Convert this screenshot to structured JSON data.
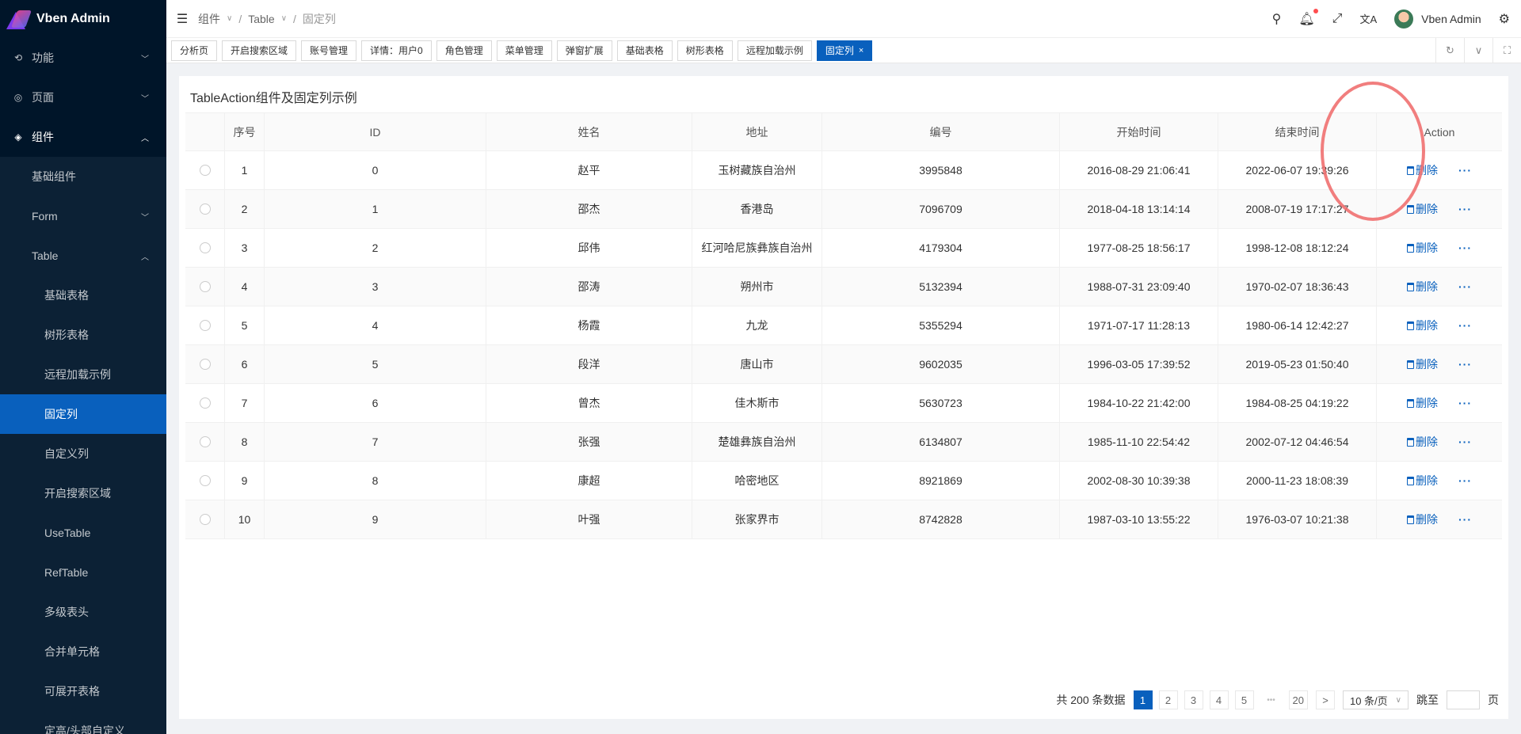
{
  "app": {
    "name": "Vben Admin"
  },
  "sidebar": {
    "items": [
      {
        "label": "功能",
        "level": 1,
        "icon": "function-icon",
        "arrow": "down"
      },
      {
        "label": "页面",
        "level": 1,
        "icon": "page-icon",
        "arrow": "down"
      },
      {
        "label": "组件",
        "level": 1,
        "icon": "component-icon",
        "arrow": "up",
        "open": true
      },
      {
        "label": "基础组件",
        "level": 2
      },
      {
        "label": "Form",
        "level": 2,
        "arrow": "down"
      },
      {
        "label": "Table",
        "level": 2,
        "arrow": "up"
      },
      {
        "label": "基础表格",
        "level": 3
      },
      {
        "label": "树形表格",
        "level": 3
      },
      {
        "label": "远程加载示例",
        "level": 3
      },
      {
        "label": "固定列",
        "level": 3,
        "active": true
      },
      {
        "label": "自定义列",
        "level": 3
      },
      {
        "label": "开启搜索区域",
        "level": 3
      },
      {
        "label": "UseTable",
        "level": 3
      },
      {
        "label": "RefTable",
        "level": 3
      },
      {
        "label": "多级表头",
        "level": 3
      },
      {
        "label": "合并单元格",
        "level": 3
      },
      {
        "label": "可展开表格",
        "level": 3
      },
      {
        "label": "定高/头部自定义",
        "level": 3
      }
    ]
  },
  "header": {
    "breadcrumb": [
      "组件",
      "Table",
      "固定列"
    ],
    "user_name": "Vben Admin"
  },
  "tabs": [
    {
      "label": "分析页"
    },
    {
      "label": "开启搜索区域"
    },
    {
      "label": "账号管理"
    },
    {
      "label": "详情：用户0"
    },
    {
      "label": "角色管理"
    },
    {
      "label": "菜单管理"
    },
    {
      "label": "弹窗扩展"
    },
    {
      "label": "基础表格"
    },
    {
      "label": "树形表格"
    },
    {
      "label": "远程加载示例"
    },
    {
      "label": "固定列",
      "active": true
    }
  ],
  "card": {
    "title": "TableAction组件及固定列示例"
  },
  "table": {
    "columns": [
      "",
      "序号",
      "ID",
      "姓名",
      "地址",
      "编号",
      "开始时间",
      "结束时间",
      "Action"
    ],
    "delete_label": "删除",
    "more_label": "···",
    "rows": [
      [
        "1",
        "0",
        "赵平",
        "玉树藏族自治州",
        "3995848",
        "2016-08-29 21:06:41",
        "2022-06-07 19:39:26"
      ],
      [
        "2",
        "1",
        "邵杰",
        "香港岛",
        "7096709",
        "2018-04-18 13:14:14",
        "2008-07-19 17:17:27"
      ],
      [
        "3",
        "2",
        "邱伟",
        "红河哈尼族彝族自治州",
        "4179304",
        "1977-08-25 18:56:17",
        "1998-12-08 18:12:24"
      ],
      [
        "4",
        "3",
        "邵涛",
        "朔州市",
        "5132394",
        "1988-07-31 23:09:40",
        "1970-02-07 18:36:43"
      ],
      [
        "5",
        "4",
        "杨霞",
        "九龙",
        "5355294",
        "1971-07-17 11:28:13",
        "1980-06-14 12:42:27"
      ],
      [
        "6",
        "5",
        "段洋",
        "唐山市",
        "9602035",
        "1996-03-05 17:39:52",
        "2019-05-23 01:50:40"
      ],
      [
        "7",
        "6",
        "曾杰",
        "佳木斯市",
        "5630723",
        "1984-10-22 21:42:00",
        "1984-08-25 04:19:22"
      ],
      [
        "8",
        "7",
        "张强",
        "楚雄彝族自治州",
        "6134807",
        "1985-11-10 22:54:42",
        "2002-07-12 04:46:54"
      ],
      [
        "9",
        "8",
        "康超",
        "哈密地区",
        "8921869",
        "2002-08-30 10:39:38",
        "2000-11-23 18:08:39"
      ],
      [
        "10",
        "9",
        "叶强",
        "张家界市",
        "8742828",
        "1987-03-10 13:55:22",
        "1976-03-07 10:21:38"
      ]
    ]
  },
  "pager": {
    "total": "共 200 条数据",
    "pages": [
      "1",
      "2",
      "3",
      "4",
      "5"
    ],
    "ellipsis": "•••",
    "last": "20",
    "next": ">",
    "size": "10 条/页",
    "jump_label": "跳至",
    "page_unit": "页"
  }
}
